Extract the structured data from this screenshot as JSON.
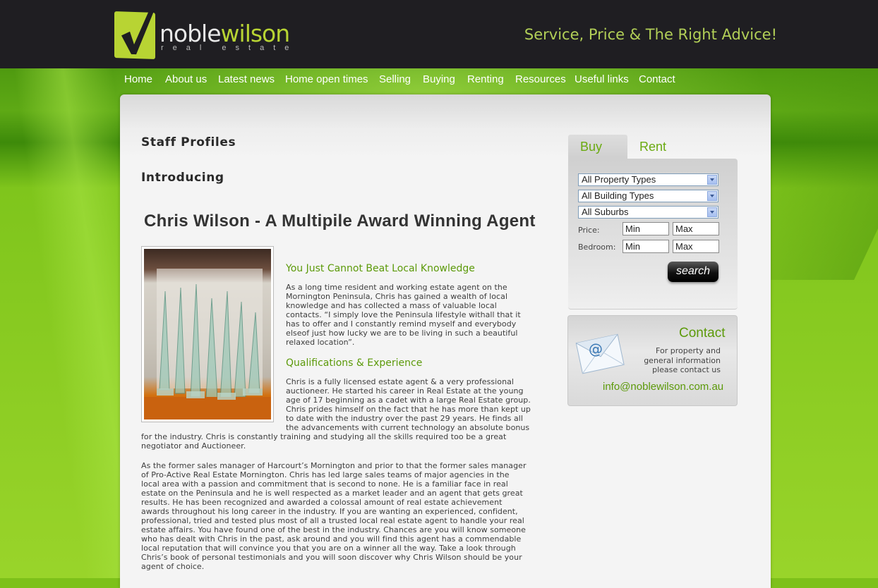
{
  "brand": {
    "name_part1": "noble",
    "name_part2": "wilson",
    "sub": "real estate",
    "tagline": "Service, Price & The Right Advice!"
  },
  "nav": [
    {
      "label": "Home"
    },
    {
      "label": "About us"
    },
    {
      "label": "Latest news"
    },
    {
      "label": "Home open times"
    },
    {
      "label": "Selling"
    },
    {
      "label": "Buying"
    },
    {
      "label": "Renting"
    },
    {
      "label": "Resources"
    },
    {
      "label": "Useful links"
    },
    {
      "label": "Contact"
    }
  ],
  "main": {
    "heading1": "Staff Profiles",
    "heading2": "Introducing",
    "title": "Chris Wilson - A Multipile Award Winning Agent",
    "section1_title": "You Just Cannot Beat Local Knowledge",
    "section1_lines": [
      "As a long time resident and working estate agent on the",
      "Mornington Peninsula, Chris has gained a wealth of local",
      "knowledge and has collected a mass of valuable local",
      "contacts. “I simply love the Peninsula lifestyle withall that it",
      "has to offer and I constantly remind myself and everybody",
      "elseof just how lucky we are to be living in such a beautiful",
      "relaxed location”."
    ],
    "section2_title": "Qualifications & Experience",
    "section2_lines_indented": [
      "Chris is a fully licensed estate agent & a very professional",
      "auctioneer. He started his career in Real Estate at the young",
      "age of 17 beginning as a cadet with a large Real Estate group.",
      "Chris prides himself on the fact that he has more than kept up",
      "to date with the industry over the past 29 years. He finds all",
      "the advancements with current technology an absolute bonus"
    ],
    "section2_lines_full": [
      "for the industry. Chris is constantly training and studying all the skills required too be a great",
      "negotiator and Auctioneer."
    ],
    "paragraph3_lines": [
      "As the former sales manager of Harcourt’s Mornington and prior to that the former sales manager",
      "of Pro-Active Real Estate Mornington. Chris has led large sales teams of major agencies in the",
      "local area with a passion and commitment that is second to none. He is a familiar face in real",
      "estate on the Peninsula and he is well respected as a market leader and an agent that gets great",
      "results. He has been recognized and awarded a colossal amount of real estate achievement",
      "awards throughout his long career in the industry. If you are wanting an experienced, confident,",
      "professional, tried and tested plus most of all a trusted local real estate agent to handle your real",
      "estate affairs. You have found one of the best in the industry. Chances are you will know someone",
      "who has dealt with Chris in the past, ask around and you will find this agent has a commendable",
      "local reputation that will convince you that you are on a winner all the way. Take a look through",
      "Chris’s book of personal testimonials and you will soon discover why Chris Wilson should be your",
      "agent of choice."
    ]
  },
  "search": {
    "tab_buy": "Buy",
    "tab_rent": "Rent",
    "property_type": "All Property Types",
    "building_type": "All Building Types",
    "suburb": "All Suburbs",
    "price_label": "Price:",
    "bedroom_label": "Bedroom:",
    "price_min": "Min",
    "price_max": "Max",
    "bed_min": "Min",
    "bed_max": "Max",
    "search_label": "search"
  },
  "contact": {
    "title": "Contact",
    "lines": [
      "For property and",
      "general information",
      "please contact us"
    ],
    "email": "info@noblewilson.com.au"
  },
  "colors": {
    "header_bg": "#1f1e22",
    "accent_green": "#5c9a0a",
    "brand_lime": "#b8d433"
  }
}
